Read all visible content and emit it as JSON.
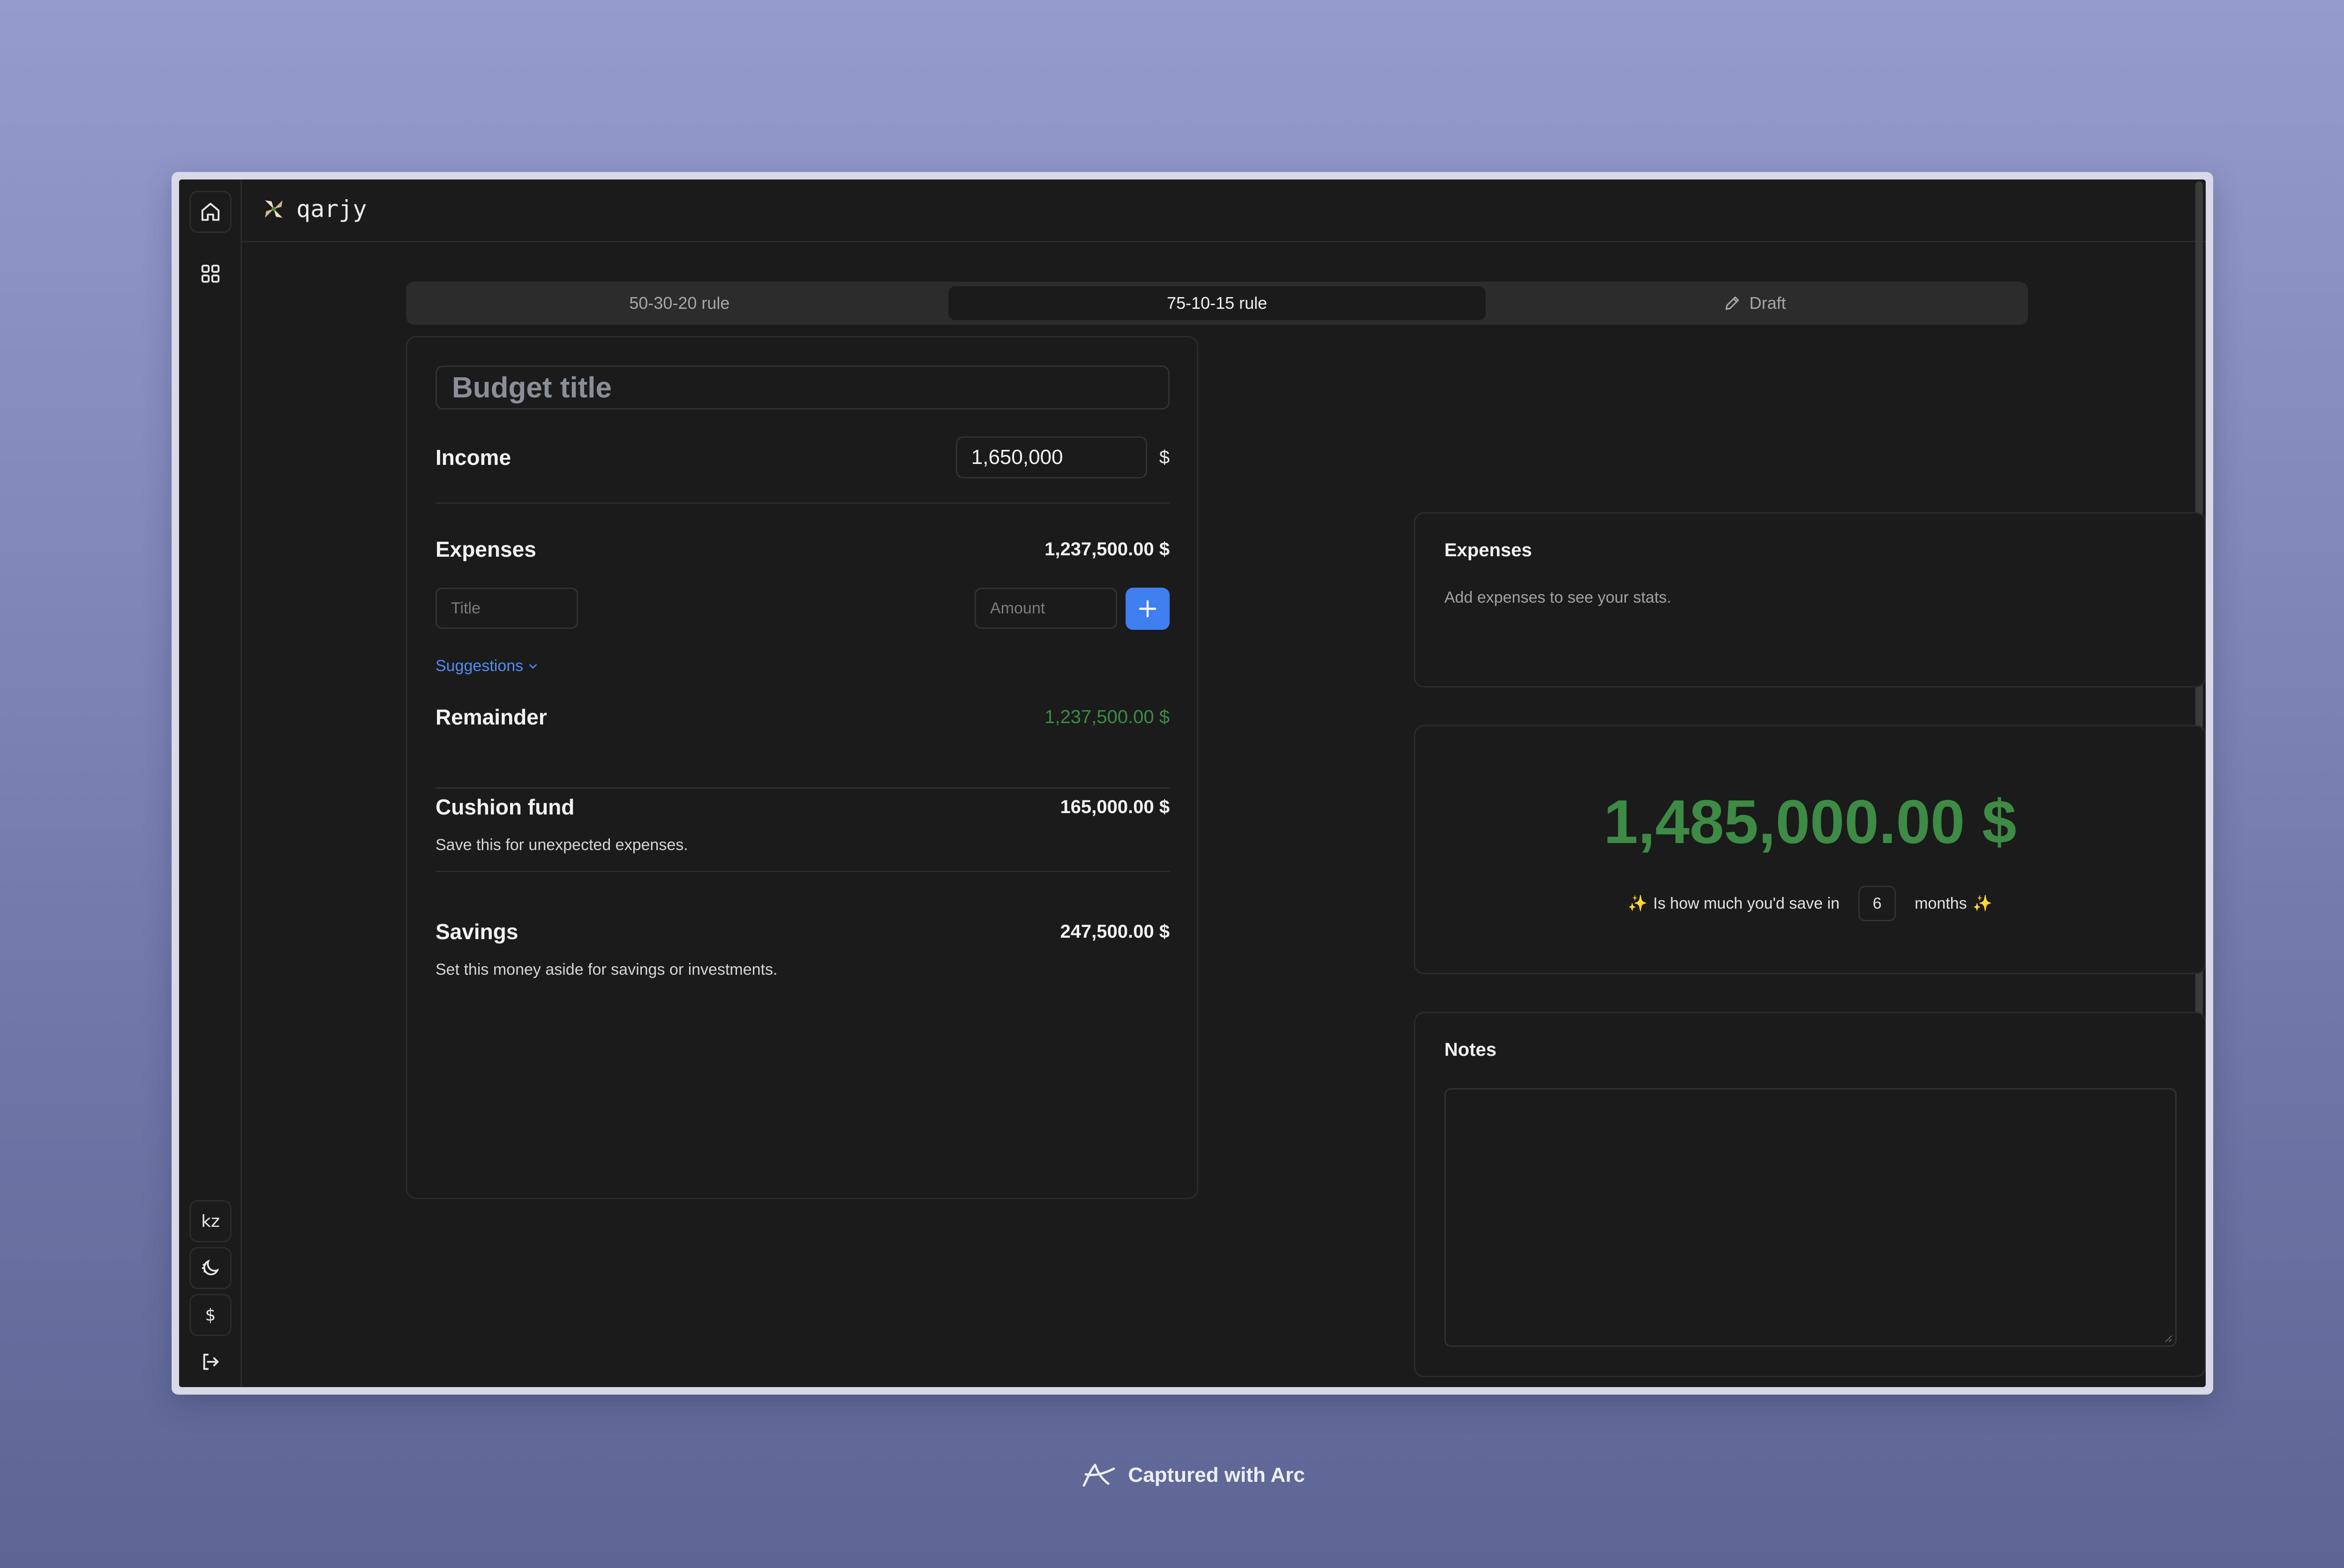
{
  "app": {
    "name": "qarjy"
  },
  "sidebar": {
    "language": "kz",
    "currency": "$"
  },
  "tabs": [
    {
      "label": "50-30-20 rule",
      "active": false
    },
    {
      "label": "75-10-15 rule",
      "active": true
    },
    {
      "label": "Draft",
      "active": false,
      "icon": "pencil-icon"
    }
  ],
  "budget": {
    "title_placeholder": "Budget title",
    "income_label": "Income",
    "income_value": "1,650,000",
    "currency_symbol": "$",
    "expenses_label": "Expenses",
    "expenses_total": "1,237,500.00 $",
    "title_input_placeholder": "Title",
    "amount_input_placeholder": "Amount",
    "suggestions_label": "Suggestions",
    "remainder_label": "Remainder",
    "remainder_value": "1,237,500.00 $",
    "cushion_label": "Cushion fund",
    "cushion_value": "165,000.00 $",
    "cushion_desc": "Save this for unexpected expenses.",
    "savings_label": "Savings",
    "savings_value": "247,500.00 $",
    "savings_desc": "Set this money aside for savings or investments."
  },
  "stats": {
    "title": "Expenses",
    "empty_text": "Add expenses to see your stats."
  },
  "savings_projection": {
    "amount": "1,485,000.00 $",
    "prefix": "Is how much you'd save in",
    "months": "6",
    "suffix": "months",
    "sparkle": "✨"
  },
  "notes": {
    "title": "Notes"
  },
  "footer": {
    "capture_text": "Captured with Arc"
  },
  "colors": {
    "accent_blue": "#3f7ff0",
    "link_blue": "#4f8df5",
    "positive_green": "#3d8b45",
    "background": "#1b1b1b"
  }
}
